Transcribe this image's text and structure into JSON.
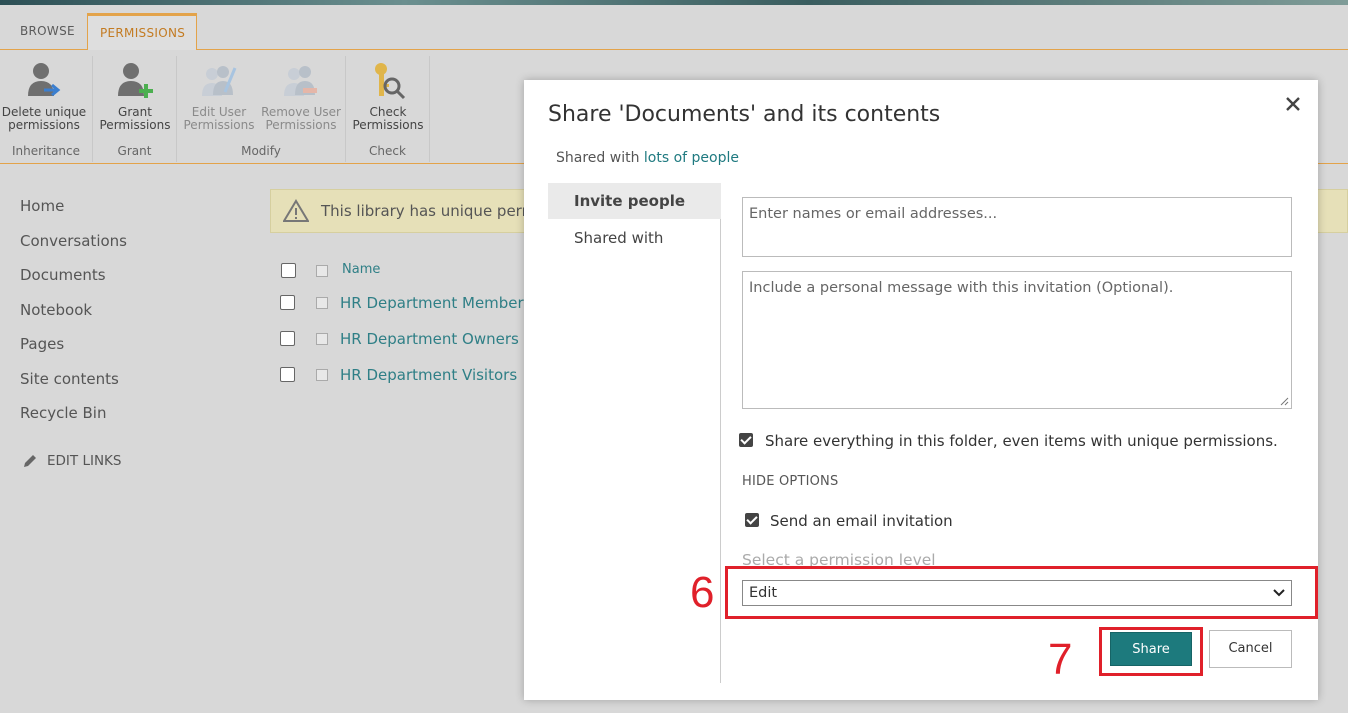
{
  "ribbon": {
    "tabs": [
      {
        "label": "BROWSE"
      },
      {
        "label": "PERMISSIONS"
      }
    ],
    "groups": [
      {
        "label": "Inheritance",
        "buttons": [
          {
            "line1": "Delete unique",
            "line2": "permissions",
            "icon": "delete-permissions-icon"
          }
        ]
      },
      {
        "label": "Grant",
        "buttons": [
          {
            "line1": "Grant",
            "line2": "Permissions",
            "icon": "grant-permissions-icon"
          }
        ]
      },
      {
        "label": "Modify",
        "buttons": [
          {
            "line1": "Edit User",
            "line2": "Permissions",
            "icon": "edit-user-permissions-icon"
          },
          {
            "line1": "Remove User",
            "line2": "Permissions",
            "icon": "remove-user-permissions-icon"
          }
        ]
      },
      {
        "label": "Check",
        "buttons": [
          {
            "line1": "Check",
            "line2": "Permissions",
            "icon": "check-permissions-icon"
          }
        ]
      }
    ]
  },
  "nav": {
    "items": [
      "Home",
      "Conversations",
      "Documents",
      "Notebook",
      "Pages",
      "Site contents",
      "Recycle Bin"
    ],
    "edit_links": "EDIT LINKS"
  },
  "warning": {
    "text": "This library has unique perm"
  },
  "list": {
    "header": "Name",
    "rows": [
      "HR Department Members",
      "HR Department Owners",
      "HR Department Visitors"
    ]
  },
  "dialog": {
    "title": "Share 'Documents' and its contents",
    "shared_prefix": "Shared with ",
    "shared_link": "lots of people",
    "side": [
      "Invite people",
      "Shared with"
    ],
    "names_placeholder": "Enter names or email addresses...",
    "message_placeholder": "Include a personal message with this invitation (Optional).",
    "share_everything_label": "Share everything in this folder, even items with unique permissions.",
    "hide_options": "HIDE OPTIONS",
    "send_email_label": "Send an email invitation",
    "permission_label": "Select a permission level",
    "permission_value": "Edit",
    "share_button": "Share",
    "cancel_button": "Cancel"
  },
  "callouts": [
    "6",
    "7"
  ],
  "colors": {
    "accent": "#e3a34a",
    "link": "#1f7a80",
    "share_button": "#1d7a7d",
    "callout": "#e0202a"
  }
}
